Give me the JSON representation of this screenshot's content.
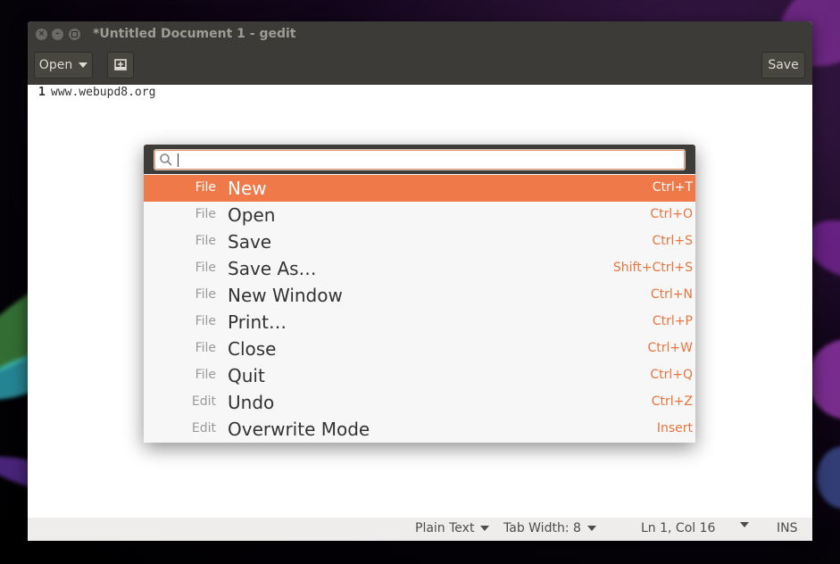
{
  "window": {
    "title": "*Untitled Document 1 - gedit",
    "controls": [
      "close",
      "minimize",
      "maximize"
    ]
  },
  "toolbar": {
    "open_label": "Open",
    "new_tab_icon": "new-document-icon",
    "save_label": "Save"
  },
  "editor": {
    "lines": [
      {
        "number": "1",
        "text": "www.webupd8.org"
      }
    ]
  },
  "hud": {
    "search_value": "",
    "search_icon": "search-icon",
    "items": [
      {
        "category": "File",
        "command": "New",
        "shortcut": "Ctrl+T",
        "selected": true
      },
      {
        "category": "File",
        "command": "Open",
        "shortcut": "Ctrl+O"
      },
      {
        "category": "File",
        "command": "Save",
        "shortcut": "Ctrl+S"
      },
      {
        "category": "File",
        "command": "Save As…",
        "shortcut": "Shift+Ctrl+S"
      },
      {
        "category": "File",
        "command": "New Window",
        "shortcut": "Ctrl+N"
      },
      {
        "category": "File",
        "command": "Print…",
        "shortcut": "Ctrl+P"
      },
      {
        "category": "File",
        "command": "Close",
        "shortcut": "Ctrl+W"
      },
      {
        "category": "File",
        "command": "Quit",
        "shortcut": "Ctrl+Q"
      },
      {
        "category": "Edit",
        "command": "Undo",
        "shortcut": "Ctrl+Z"
      },
      {
        "category": "Edit",
        "command": "Overwrite Mode",
        "shortcut": "Insert"
      }
    ],
    "accent_color": "#f0794a",
    "shortcut_color": "#e8753f"
  },
  "statusbar": {
    "language": "Plain Text",
    "tab_width": "Tab Width: 8",
    "position": "Ln 1, Col 16",
    "mode": "INS"
  }
}
